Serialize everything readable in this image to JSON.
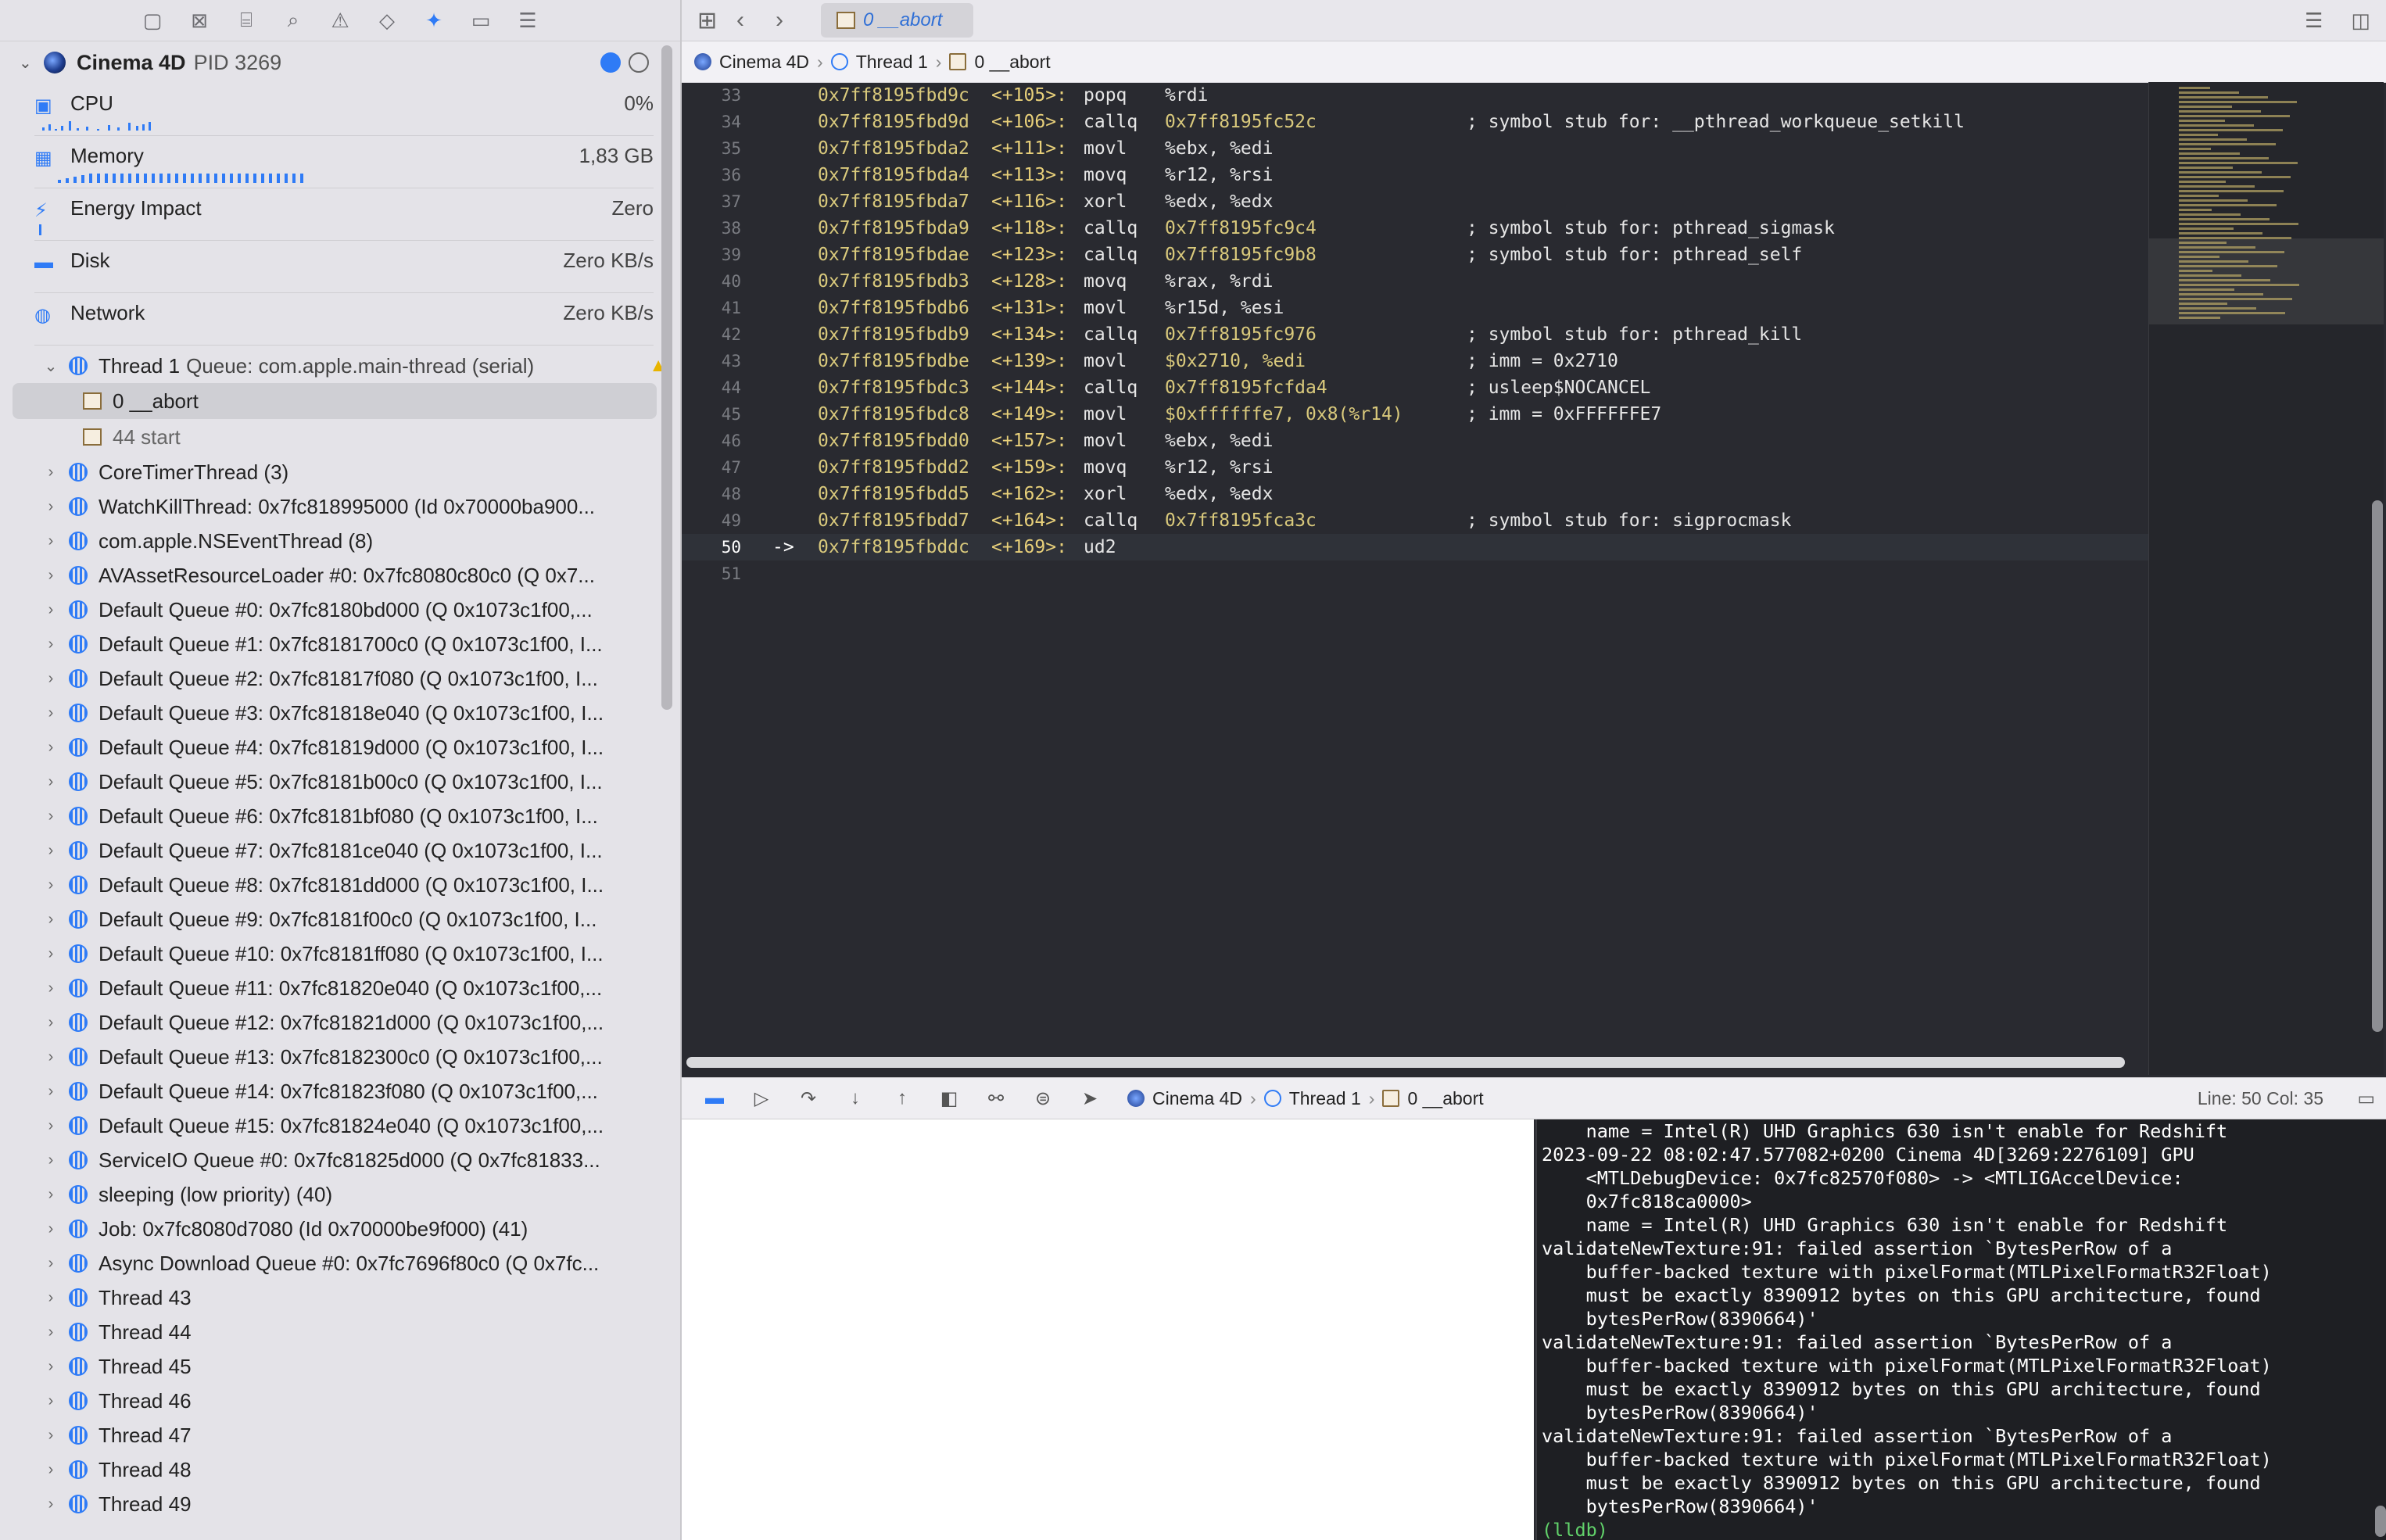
{
  "navigator": {
    "process": {
      "name": "Cinema 4D",
      "pid": "PID 3269"
    },
    "gauges": [
      {
        "label": "CPU",
        "value": "0%",
        "icon": "cpu-icon"
      },
      {
        "label": "Memory",
        "value": "1,83 GB",
        "icon": "memory-icon"
      },
      {
        "label": "Energy Impact",
        "value": "Zero",
        "icon": "energy-icon"
      },
      {
        "label": "Disk",
        "value": "Zero KB/s",
        "icon": "disk-icon"
      },
      {
        "label": "Network",
        "value": "Zero KB/s",
        "icon": "network-icon"
      }
    ],
    "thread1": {
      "name": "Thread 1",
      "queue": "Queue: com.apple.main-thread (serial)"
    },
    "frames": [
      {
        "label": "0 __abort",
        "selected": true
      },
      {
        "label": "44 start",
        "selected": false
      }
    ],
    "threads": [
      "CoreTimerThread (3)",
      "WatchKillThread: 0x7fc818995000 (Id 0x70000ba900...",
      "com.apple.NSEventThread (8)",
      "AVAssetResourceLoader #0: 0x7fc8080c80c0 (Q 0x7...",
      "Default Queue #0: 0x7fc8180bd000 (Q 0x1073c1f00,...",
      "Default Queue #1: 0x7fc8181700c0 (Q 0x1073c1f00, I...",
      "Default Queue #2: 0x7fc81817f080 (Q 0x1073c1f00, I...",
      "Default Queue #3: 0x7fc81818e040 (Q 0x1073c1f00, I...",
      "Default Queue #4: 0x7fc81819d000 (Q 0x1073c1f00, I...",
      "Default Queue #5: 0x7fc8181b00c0 (Q 0x1073c1f00, I...",
      "Default Queue #6: 0x7fc8181bf080 (Q 0x1073c1f00, I...",
      "Default Queue #7: 0x7fc8181ce040 (Q 0x1073c1f00, I...",
      "Default Queue #8: 0x7fc8181dd000 (Q 0x1073c1f00, I...",
      "Default Queue #9: 0x7fc8181f00c0 (Q 0x1073c1f00, I...",
      "Default Queue #10: 0x7fc8181ff080 (Q 0x1073c1f00, I...",
      "Default Queue #11: 0x7fc81820e040 (Q 0x1073c1f00,...",
      "Default Queue #12: 0x7fc81821d000 (Q 0x1073c1f00,...",
      "Default Queue #13: 0x7fc8182300c0 (Q 0x1073c1f00,...",
      "Default Queue #14: 0x7fc81823f080 (Q 0x1073c1f00,...",
      "Default Queue #15: 0x7fc81824e040 (Q 0x1073c1f00,...",
      "ServiceIO Queue #0: 0x7fc81825d000 (Q 0x7fc81833...",
      "sleeping (low priority) (40)",
      "Job: 0x7fc8080d7080 (Id 0x70000be9f000) (41)",
      "Async Download Queue #0: 0x7fc7696f80c0 (Q 0x7fc...",
      "Thread 43",
      "Thread 44",
      "Thread 45",
      "Thread 46",
      "Thread 47",
      "Thread 48",
      "Thread 49"
    ]
  },
  "editor": {
    "tab": "0 __abort",
    "jumpbar": [
      "Cinema 4D",
      "Thread 1",
      "0 __abort"
    ],
    "lines": [
      {
        "n": "33",
        "addr": "0x7ff8195fbd9c",
        "off": "<+105>:",
        "ins": "popq",
        "ops": "%rdi",
        "cmt": ""
      },
      {
        "n": "34",
        "addr": "0x7ff8195fbd9d",
        "off": "<+106>:",
        "ins": "callq",
        "ops": "0x7ff8195fc52c",
        "cmt": "; symbol stub for: __pthread_workqueue_setkill"
      },
      {
        "n": "35",
        "addr": "0x7ff8195fbda2",
        "off": "<+111>:",
        "ins": "movl",
        "ops": "%ebx, %edi",
        "cmt": ""
      },
      {
        "n": "36",
        "addr": "0x7ff8195fbda4",
        "off": "<+113>:",
        "ins": "movq",
        "ops": "%r12, %rsi",
        "cmt": ""
      },
      {
        "n": "37",
        "addr": "0x7ff8195fbda7",
        "off": "<+116>:",
        "ins": "xorl",
        "ops": "%edx, %edx",
        "cmt": ""
      },
      {
        "n": "38",
        "addr": "0x7ff8195fbda9",
        "off": "<+118>:",
        "ins": "callq",
        "ops": "0x7ff8195fc9c4",
        "cmt": "; symbol stub for: pthread_sigmask"
      },
      {
        "n": "39",
        "addr": "0x7ff8195fbdae",
        "off": "<+123>:",
        "ins": "callq",
        "ops": "0x7ff8195fc9b8",
        "cmt": "; symbol stub for: pthread_self"
      },
      {
        "n": "40",
        "addr": "0x7ff8195fbdb3",
        "off": "<+128>:",
        "ins": "movq",
        "ops": "%rax, %rdi",
        "cmt": ""
      },
      {
        "n": "41",
        "addr": "0x7ff8195fbdb6",
        "off": "<+131>:",
        "ins": "movl",
        "ops": "%r15d, %esi",
        "cmt": ""
      },
      {
        "n": "42",
        "addr": "0x7ff8195fbdb9",
        "off": "<+134>:",
        "ins": "callq",
        "ops": "0x7ff8195fc976",
        "cmt": "; symbol stub for: pthread_kill"
      },
      {
        "n": "43",
        "addr": "0x7ff8195fbdbe",
        "off": "<+139>:",
        "ins": "movl",
        "ops": "$0x2710, %edi",
        "cmt": "; imm = 0x2710"
      },
      {
        "n": "44",
        "addr": "0x7ff8195fbdc3",
        "off": "<+144>:",
        "ins": "callq",
        "ops": "0x7ff8195fcfda4",
        "cmt": "; usleep$NOCANCEL"
      },
      {
        "n": "45",
        "addr": "0x7ff8195fbdc8",
        "off": "<+149>:",
        "ins": "movl",
        "ops": "$0xffffffe7, 0x8(%r14)",
        "cmt": "; imm = 0xFFFFFFE7"
      },
      {
        "n": "46",
        "addr": "0x7ff8195fbdd0",
        "off": "<+157>:",
        "ins": "movl",
        "ops": "%ebx, %edi",
        "cmt": ""
      },
      {
        "n": "47",
        "addr": "0x7ff8195fbdd2",
        "off": "<+159>:",
        "ins": "movq",
        "ops": "%r12, %rsi",
        "cmt": ""
      },
      {
        "n": "48",
        "addr": "0x7ff8195fbdd5",
        "off": "<+162>:",
        "ins": "xorl",
        "ops": "%edx, %edx",
        "cmt": ""
      },
      {
        "n": "49",
        "addr": "0x7ff8195fbdd7",
        "off": "<+164>:",
        "ins": "callq",
        "ops": "0x7ff8195fca3c",
        "cmt": "; symbol stub for: sigprocmask"
      },
      {
        "n": "50",
        "addr": "0x7ff8195fbddc",
        "off": "<+169>:",
        "ins": "ud2",
        "ops": "",
        "cmt": "",
        "current": true,
        "arrow": "->"
      },
      {
        "n": "51",
        "addr": "",
        "off": "",
        "ins": "",
        "ops": "",
        "cmt": ""
      }
    ]
  },
  "debugbar": {
    "crumbs": [
      "Cinema 4D",
      "Thread 1",
      "0 __abort"
    ],
    "line_col": "Line: 50  Col: 35"
  },
  "console": {
    "lines": [
      "    name = Intel(R) UHD Graphics 630 isn't enable for Redshift",
      "2023-09-22 08:02:47.577082+0200 Cinema 4D[3269:2276109] GPU",
      "    <MTLDebugDevice: 0x7fc82570f080> -> <MTLIGAccelDevice:",
      "    0x7fc818ca0000>",
      "    name = Intel(R) UHD Graphics 630 isn't enable for Redshift",
      "validateNewTexture:91: failed assertion `BytesPerRow of a",
      "    buffer-backed texture with pixelFormat(MTLPixelFormatR32Float)",
      "    must be exactly 8390912 bytes on this GPU architecture, found",
      "    bytesPerRow(8390664)'",
      "validateNewTexture:91: failed assertion `BytesPerRow of a",
      "    buffer-backed texture with pixelFormat(MTLPixelFormatR32Float)",
      "    must be exactly 8390912 bytes on this GPU architecture, found",
      "    bytesPerRow(8390664)'",
      "validateNewTexture:91: failed assertion `BytesPerRow of a",
      "    buffer-backed texture with pixelFormat(MTLPixelFormatR32Float)",
      "    must be exactly 8390912 bytes on this GPU architecture, found",
      "    bytesPerRow(8390664)'"
    ],
    "prompt": "(lldb)"
  }
}
